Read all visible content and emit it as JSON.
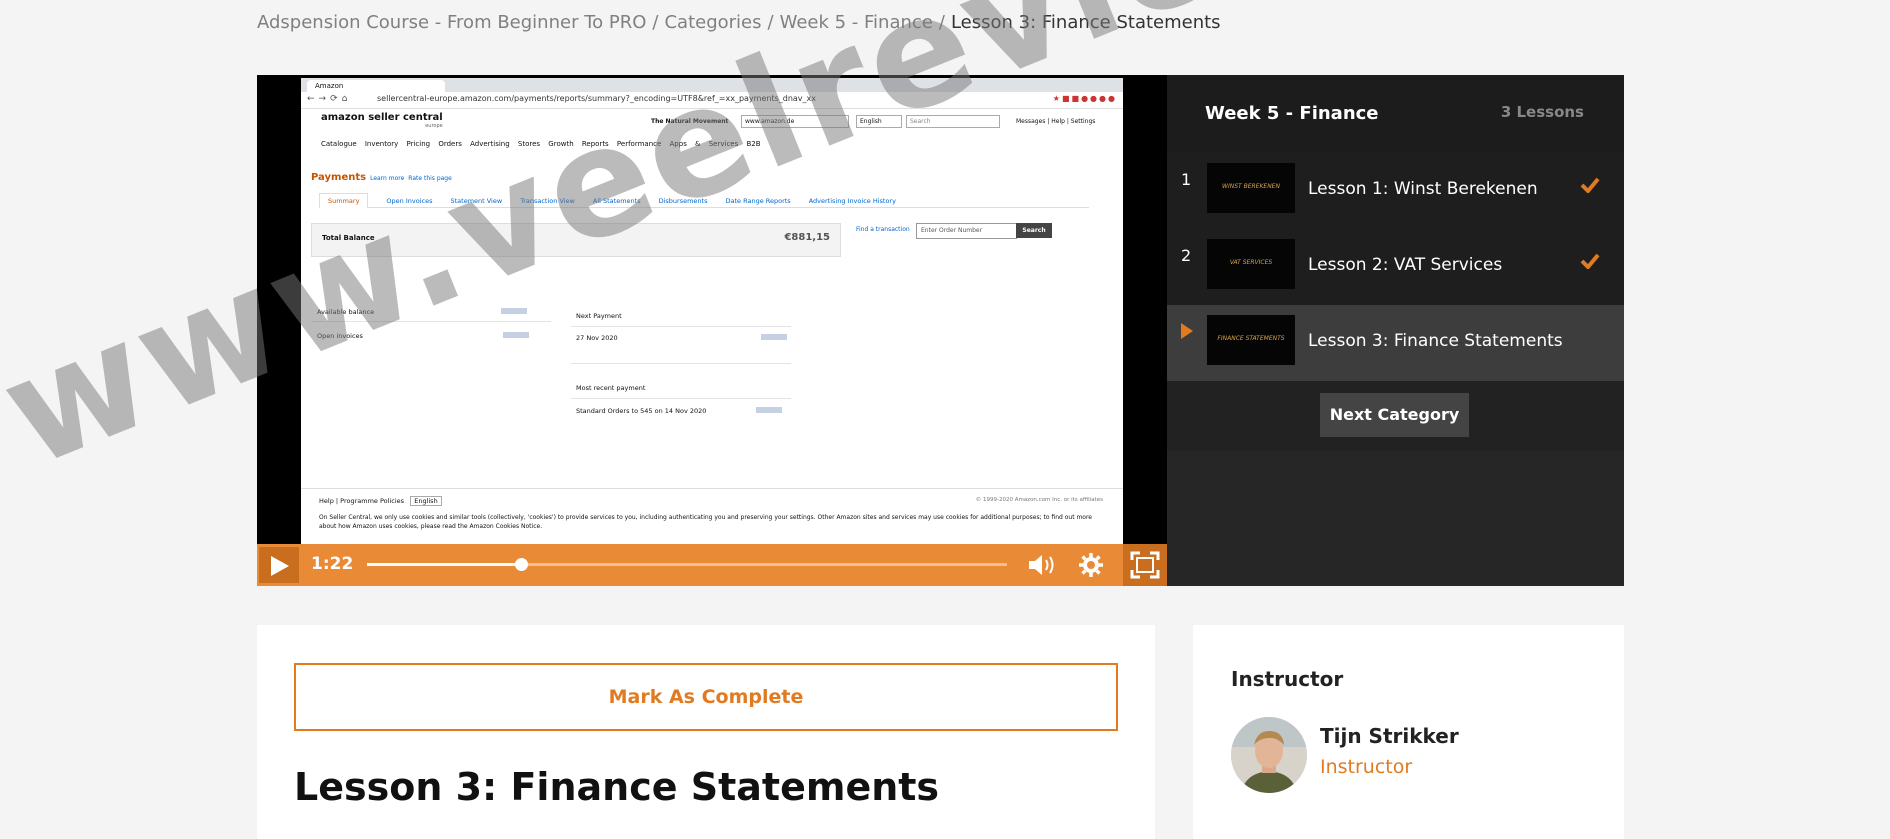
{
  "breadcrumb": {
    "items": [
      "Adspension Course - From Beginner To PRO",
      "Categories",
      "Week 5 - Finance"
    ],
    "current": "Lesson 3: Finance Statements",
    "separator": "/"
  },
  "player": {
    "time": "1:22",
    "progress": 0.24,
    "accent": "#e98a37",
    "screen": {
      "tab_title": "Amazon",
      "url": "sellercentral-europe.amazon.com/payments/reports/summary?_encoding=UTF8&ref_=xx_payments_dnav_xx",
      "logo": "amazon seller central",
      "logo_sub": "europe",
      "store_name": "The Natural Movement",
      "marketplace": "www.amazon.de",
      "language": "English",
      "search_placeholder": "Search",
      "header_links": "Messages | Help | Settings",
      "menu": "Catalogue Inventory Pricing Orders Advertising Stores Growth Reports Performance Apps & Services B2B",
      "payments_title": "Payments",
      "learn_more": "Learn more",
      "rate_page": "Rate this page",
      "subtabs": [
        "Summary",
        "Open Invoices",
        "Statement View",
        "Transaction View",
        "All Statements",
        "Disbursements",
        "Date Range Reports",
        "Advertising Invoice History"
      ],
      "total_balance_label": "Total Balance",
      "total_balance_value": "€881,15",
      "find_transaction": "Find a transaction",
      "order_placeholder": "Enter Order Number",
      "search_button": "Search",
      "available_balance": "Available balance",
      "open_invoices": "Open invoices",
      "next_payment": "Next Payment",
      "next_payment_date": "27 Nov 2020",
      "most_recent_payment": "Most recent payment",
      "recent_payment_desc": "Standard Orders to 545 on 14 Nov 2020",
      "footer_links": "Help | Programme Policies",
      "footer_language": "English",
      "copyright": "© 1999-2020 Amazon.com Inc. or its affiliates",
      "cookie_note": "On Seller Central, we only use cookies and similar tools (collectively, 'cookies') to provide services to you, including authenticating you and preserving your settings. Other Amazon sites and services may use cookies for additional purposes; to find out more about how Amazon uses cookies, please read the Amazon Cookies Notice."
    }
  },
  "playlist": {
    "title": "Week 5 - Finance",
    "count": "3 Lessons",
    "lessons": [
      {
        "num": "1",
        "title": "Lesson 1: Winst Berekenen",
        "thumb": "WINST BEREKENEN",
        "completed": true
      },
      {
        "num": "2",
        "title": "Lesson 2: VAT Services",
        "thumb": "VAT SERVICES",
        "completed": true
      },
      {
        "num": "",
        "title": "Lesson 3: Finance Statements",
        "thumb": "FINANCE STATEMENTS",
        "completed": false
      }
    ],
    "next_category": "Next Category"
  },
  "main": {
    "mark_complete": "Mark As Complete",
    "heading": "Lesson 3: Finance Statements"
  },
  "instructor": {
    "section_title": "Instructor",
    "name": "Tijn Strikker",
    "role": "Instructor"
  },
  "watermark": "www.veelreviews.nl",
  "colors": {
    "accent": "#e07b22",
    "panel": "#222222",
    "active_lesson": "#3d3d3d"
  }
}
